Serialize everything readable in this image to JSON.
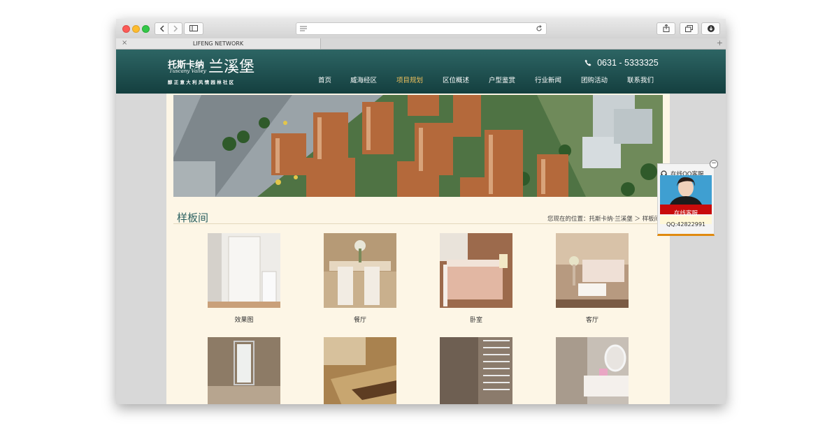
{
  "browser": {
    "tab_title": "LIFENG NETWORK",
    "tab_close": "×",
    "tab_add": "+"
  },
  "site": {
    "logo_script": "托斯卡纳",
    "logo_sub_en": "Tuscany Valley",
    "logo_name": "兰溪堡",
    "logo_slogan": "醇 正 意 大 利 风 情 园 林 社 区",
    "phone": "0631 - 5333325"
  },
  "nav": {
    "items": [
      {
        "label": "首页",
        "active": false
      },
      {
        "label": "威海经区",
        "active": false
      },
      {
        "label": "项目规划",
        "active": true
      },
      {
        "label": "区位概述",
        "active": false
      },
      {
        "label": "户型鉴赏",
        "active": false
      },
      {
        "label": "行业新闻",
        "active": false
      },
      {
        "label": "团购活动",
        "active": false
      },
      {
        "label": "联系我们",
        "active": false
      }
    ]
  },
  "section": {
    "title": "样板间",
    "breadcrumb": "您现在的位置：托斯卡纳·兰溪堡 ＞ 样板间"
  },
  "gallery": {
    "items": [
      {
        "label": "效果图"
      },
      {
        "label": "餐厅"
      },
      {
        "label": "卧室"
      },
      {
        "label": "客厅"
      },
      {
        "label": ""
      },
      {
        "label": ""
      },
      {
        "label": ""
      },
      {
        "label": ""
      }
    ]
  },
  "qq_widget": {
    "title": "在线QQ客服",
    "button": "在线客服",
    "number": "QQ:42822991",
    "minimize": "−"
  },
  "colors": {
    "header_top": "#2d6564",
    "header_bottom": "#143f3f",
    "nav_active": "#f2c25c",
    "content_bg": "#fdf6e6",
    "section_title": "#2a6060",
    "qq_button": "#c80b0b",
    "qq_accent": "#e08a10"
  },
  "icons": [
    "back-icon",
    "forward-icon",
    "sidebar-icon",
    "reader-icon",
    "reload-icon",
    "share-icon",
    "tabs-icon",
    "download-icon",
    "phone-icon",
    "headset-icon"
  ]
}
